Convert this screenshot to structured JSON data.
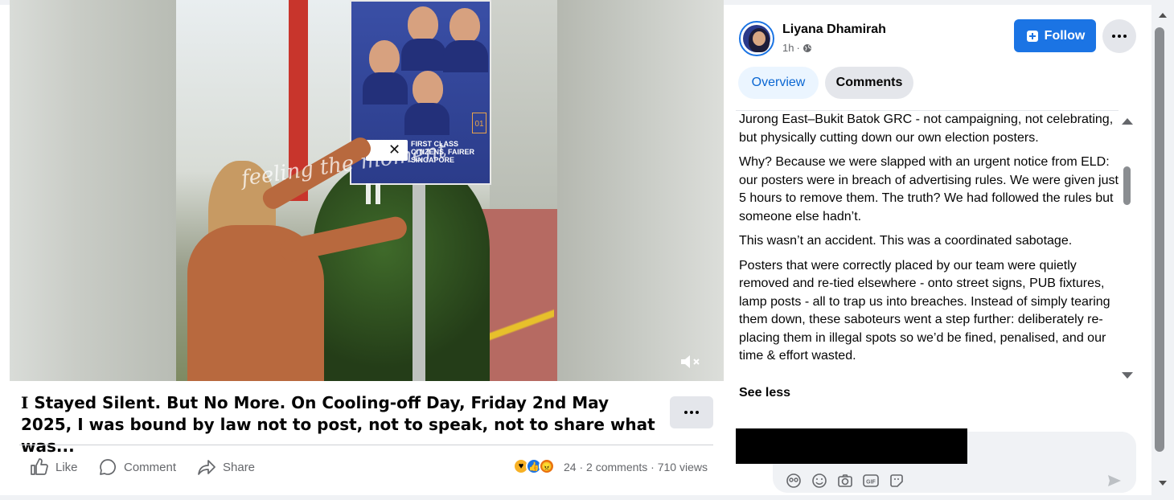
{
  "video": {
    "poster_slogan": "FIRST CLASS CITIZENS, FAIRER SINGAPORE",
    "poster_number": "01",
    "watermark": "feeling the moment"
  },
  "post": {
    "caption_first_word": "I",
    "caption_rest": " Stayed Silent. But No More. On Cooling-off Day, Friday 2nd May 2025, I was bound by law not to post, not to speak, not to share what was...",
    "actions": {
      "like": "Like",
      "comment": "Comment",
      "share": "Share"
    },
    "reaction_count": "24",
    "comments_count": "2 comments",
    "views": "710 views",
    "separator": "·"
  },
  "author": {
    "name": "Liyana Dhamirah",
    "time": "1h",
    "meta_sep": "·",
    "follow_label": "Follow"
  },
  "tabs": {
    "overview": "Overview",
    "comments": "Comments"
  },
  "body": {
    "paragraphs": [
      "Jurong East–Bukit Batok GRC - not campaigning, not celebrating, but physically cutting down our own election posters.",
      "Why? Because we were slapped with an urgent notice from ELD: our posters were in breach of advertising rules. We were given just 5 hours to remove them. The truth? We had followed the rules but someone else hadn’t.",
      "This wasn’t an accident. This was a coordinated sabotage.",
      "Posters that were correctly placed by our team were quietly removed and re-tied elsewhere - onto street signs, PUB fixtures, lamp posts - all to trap us into breaches. Instead of simply tearing them down, these saboteurs went a step further: deliberately re-placing them in illegal spots so we’d be fined, penalised, and our time & effort wasted."
    ],
    "see_less": "See less"
  },
  "composer": {
    "icons": [
      "avatar-sticker-icon",
      "emoji-icon",
      "camera-icon",
      "gif-icon",
      "sticker-icon"
    ],
    "gif_label": "GIF"
  },
  "colors": {
    "accent": "#1b74e4",
    "tab_active_bg": "#ebf5ff",
    "muted": "#65676b"
  }
}
